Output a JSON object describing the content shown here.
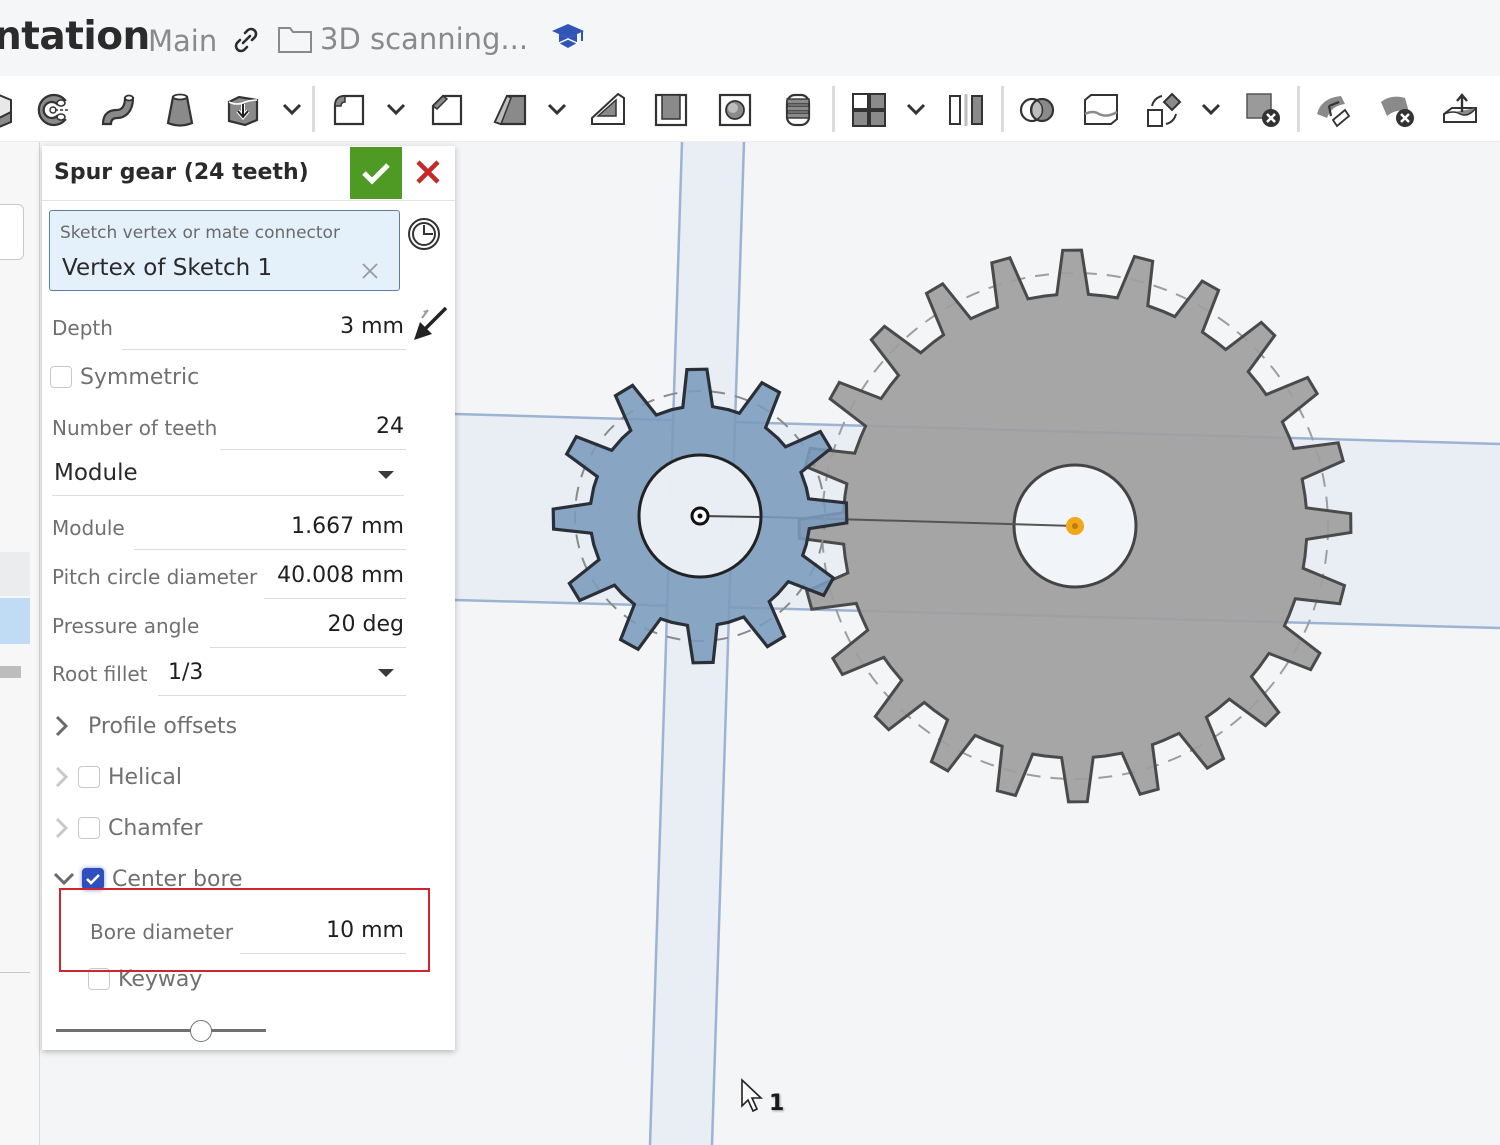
{
  "header": {
    "document_title": "ntation",
    "branch": "Main",
    "folder_name": "3D scanning...",
    "icons": [
      "link-icon",
      "folder-icon",
      "learning-center-icon"
    ]
  },
  "toolbar": {
    "items": [
      {
        "name": "extrude-icon",
        "has_dropdown": false
      },
      {
        "name": "revolve-icon",
        "has_dropdown": false
      },
      {
        "name": "sweep-icon",
        "has_dropdown": false
      },
      {
        "name": "loft-icon",
        "has_dropdown": false
      },
      {
        "name": "thicken-icon",
        "has_dropdown": true
      },
      {
        "name": "fillet-icon",
        "has_dropdown": true
      },
      {
        "name": "chamfer-icon",
        "has_dropdown": false
      },
      {
        "name": "draft-icon",
        "has_dropdown": true
      },
      {
        "name": "rib-icon",
        "has_dropdown": false
      },
      {
        "name": "shell-icon",
        "has_dropdown": false
      },
      {
        "name": "hole-icon",
        "has_dropdown": false
      },
      {
        "name": "thread-icon",
        "has_dropdown": false
      },
      {
        "name": "pattern-icon",
        "has_dropdown": true
      },
      {
        "name": "mirror-icon",
        "has_dropdown": false
      },
      {
        "name": "boolean-icon",
        "has_dropdown": false
      },
      {
        "name": "split-icon",
        "has_dropdown": false
      },
      {
        "name": "transform-icon",
        "has_dropdown": true
      },
      {
        "name": "delete-part-icon",
        "has_dropdown": false
      },
      {
        "name": "modify-fillet-icon",
        "has_dropdown": false
      },
      {
        "name": "delete-face-icon",
        "has_dropdown": false
      },
      {
        "name": "offset-surface-icon",
        "has_dropdown": false
      }
    ]
  },
  "dialog": {
    "title": "Spur gear (24 teeth)",
    "selection": {
      "label": "Sketch vertex or mate connector",
      "value": "Vertex of Sketch 1"
    },
    "depth": {
      "label": "Depth",
      "value": "3 mm"
    },
    "symmetric": {
      "label": "Symmetric",
      "checked": false
    },
    "teeth": {
      "label": "Number of teeth",
      "value": "24"
    },
    "mode_select": {
      "value": "Module"
    },
    "module": {
      "label": "Module",
      "value": "1.667 mm"
    },
    "pitch_diameter": {
      "label": "Pitch circle diameter",
      "value": "40.008 mm"
    },
    "pressure_angle": {
      "label": "Pressure angle",
      "value": "20 deg"
    },
    "root_fillet": {
      "label": "Root fillet",
      "value": "1/3"
    },
    "profile_offsets": {
      "label": "Profile offsets",
      "expanded": false
    },
    "helical": {
      "label": "Helical",
      "checked": false
    },
    "chamfer": {
      "label": "Chamfer",
      "checked": false
    },
    "center_bore": {
      "label": "Center bore",
      "checked": true,
      "expanded": true
    },
    "bore_diameter": {
      "label": "Bore diameter",
      "value": "10 mm"
    },
    "keyway": {
      "label": "Keyway",
      "checked": false
    },
    "slider": {
      "value_fraction": 0.69
    }
  },
  "viewport": {
    "small_gear": {
      "teeth": 12,
      "fill": "#7a9bbd",
      "role": "preview"
    },
    "large_gear": {
      "teeth": 24,
      "fill": "#9e9e9e",
      "role": "existing"
    },
    "origin_point_color": "#f0a818"
  },
  "cursor": {
    "badge": "1"
  }
}
